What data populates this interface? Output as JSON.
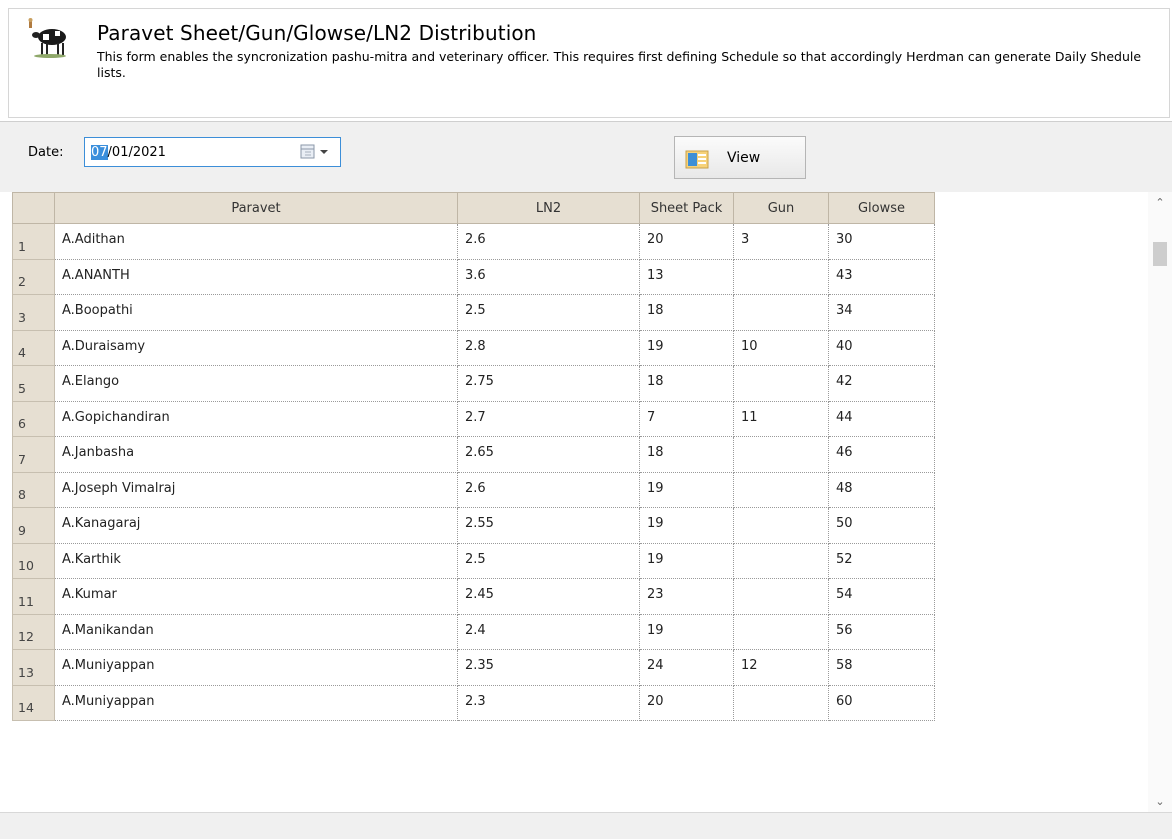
{
  "header": {
    "title": "Paravet Sheet/Gun/Glowse/LN2 Distribution",
    "description": "This form enables the syncronization pashu-mitra and veterinary officer.  This requires first defining Schedule  so that accordingly Herdman can generate Daily Shedule lists.",
    "icon": "cow-logo-icon"
  },
  "filter": {
    "date_label": "Date:",
    "date_selected_part": "07",
    "date_rest": "/01/2021",
    "calendar_icon": "calendar-dropdown-icon"
  },
  "view_button": {
    "label": "View",
    "icon": "view-report-icon"
  },
  "grid": {
    "columns": [
      "Paravet",
      "LN2",
      "Sheet Pack",
      "Gun",
      "Glowse"
    ],
    "rows": [
      {
        "num": "1",
        "paravet": "A.Adithan",
        "ln2": "2.6",
        "sheet": "20",
        "gun": "3",
        "glowse": "30"
      },
      {
        "num": "2",
        "paravet": "A.ANANTH",
        "ln2": "3.6",
        "sheet": "13",
        "gun": "",
        "glowse": "43"
      },
      {
        "num": "3",
        "paravet": "A.Boopathi",
        "ln2": "2.5",
        "sheet": "18",
        "gun": "",
        "glowse": "34"
      },
      {
        "num": "4",
        "paravet": "A.Duraisamy",
        "ln2": "2.8",
        "sheet": "19",
        "gun": "10",
        "glowse": "40"
      },
      {
        "num": "5",
        "paravet": "A.Elango",
        "ln2": "2.75",
        "sheet": "18",
        "gun": "",
        "glowse": "42"
      },
      {
        "num": "6",
        "paravet": "A.Gopichandiran",
        "ln2": "2.7",
        "sheet": "7",
        "gun": "11",
        "glowse": "44"
      },
      {
        "num": "7",
        "paravet": "A.Janbasha",
        "ln2": "2.65",
        "sheet": "18",
        "gun": "",
        "glowse": "46"
      },
      {
        "num": "8",
        "paravet": "A.Joseph Vimalraj",
        "ln2": "2.6",
        "sheet": "19",
        "gun": "",
        "glowse": "48"
      },
      {
        "num": "9",
        "paravet": "A.Kanagaraj",
        "ln2": "2.55",
        "sheet": "19",
        "gun": "",
        "glowse": "50"
      },
      {
        "num": "10",
        "paravet": "A.Karthik",
        "ln2": "2.5",
        "sheet": "19",
        "gun": "",
        "glowse": "52"
      },
      {
        "num": "11",
        "paravet": "A.Kumar",
        "ln2": "2.45",
        "sheet": "23",
        "gun": "",
        "glowse": "54"
      },
      {
        "num": "12",
        "paravet": "A.Manikandan",
        "ln2": "2.4",
        "sheet": "19",
        "gun": "",
        "glowse": "56"
      },
      {
        "num": "13",
        "paravet": "A.Muniyappan",
        "ln2": "2.35",
        "sheet": "24",
        "gun": "12",
        "glowse": "58"
      },
      {
        "num": "14",
        "paravet": "A.Muniyappan",
        "ln2": "2.3",
        "sheet": "20",
        "gun": "",
        "glowse": "60"
      }
    ]
  },
  "scrollbar": {
    "up_icon": "scroll-up-arrow-icon",
    "down_icon": "scroll-down-arrow-icon"
  }
}
